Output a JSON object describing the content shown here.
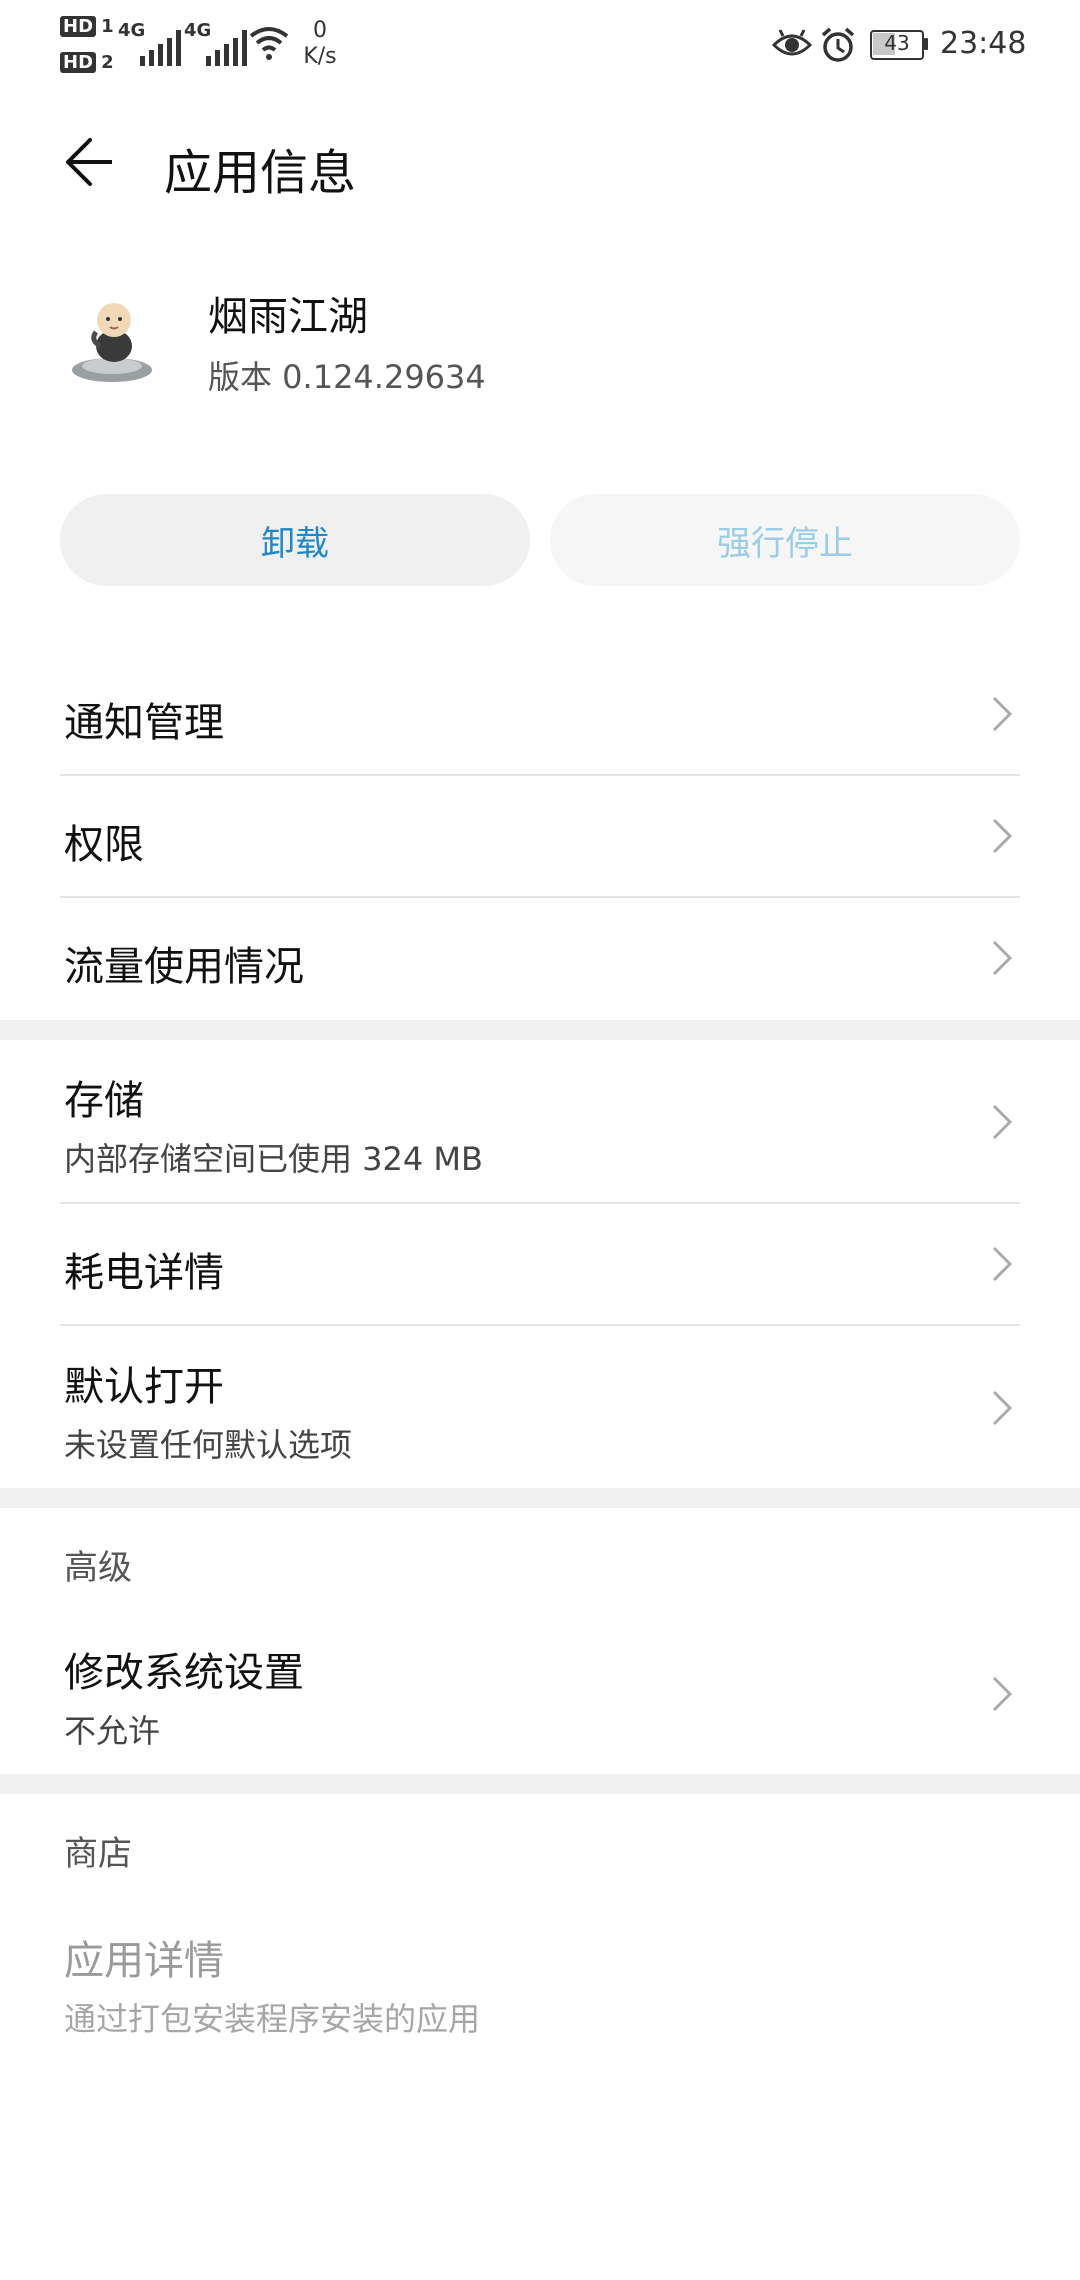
{
  "status_bar": {
    "sim1": "HD",
    "sim1_index": "1",
    "sim2": "HD",
    "sim2_index": "2",
    "net1": "4G",
    "net2": "4G",
    "speed_value": "0",
    "speed_unit": "K/s",
    "battery": "43",
    "time": "23:48",
    "icons": [
      "eye-icon",
      "alarm-icon",
      "battery-icon",
      "wifi-icon",
      "signal-icon"
    ]
  },
  "header": {
    "title": "应用信息"
  },
  "app": {
    "name": "烟雨江湖",
    "version": "版本 0.124.29634"
  },
  "buttons": {
    "uninstall": "卸载",
    "force_stop": "强行停止"
  },
  "list_1": [
    {
      "title": "通知管理"
    },
    {
      "title": "权限"
    },
    {
      "title": "流量使用情况"
    }
  ],
  "list_2": {
    "storage_title": "存储",
    "storage_sub": "内部存储空间已使用 324 MB",
    "battery_title": "耗电详情",
    "default_title": "默认打开",
    "default_sub": "未设置任何默认选项"
  },
  "advanced": {
    "header": "高级",
    "modify_title": "修改系统设置",
    "modify_sub": "不允许"
  },
  "store": {
    "header": "商店",
    "details_title": "应用详情",
    "details_sub": "通过打包安装程序安装的应用"
  },
  "colors": {
    "accent": "#1e88c8",
    "accent_disabled": "#9bcce8",
    "divider": "#e4e4e4",
    "section_gap": "#f1f1f1"
  }
}
